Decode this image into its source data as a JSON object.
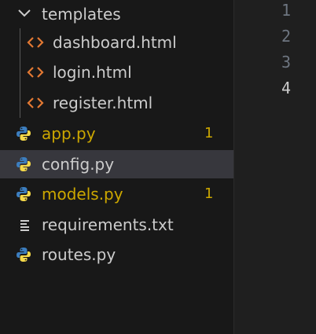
{
  "explorer": {
    "folder": {
      "name": "templates",
      "expanded": true,
      "icon": "chevron-down-icon"
    },
    "folder_files": [
      {
        "name": "dashboard.html",
        "icon": "html-icon"
      },
      {
        "name": "login.html",
        "icon": "html-icon"
      },
      {
        "name": "register.html",
        "icon": "html-icon"
      }
    ],
    "files": [
      {
        "name": "app.py",
        "icon": "python-icon",
        "badge": "1",
        "status": "warning"
      },
      {
        "name": "config.py",
        "icon": "python-icon",
        "badge": "",
        "status": "selected"
      },
      {
        "name": "models.py",
        "icon": "python-icon",
        "badge": "1",
        "status": "warning"
      },
      {
        "name": "requirements.txt",
        "icon": "text-file-icon",
        "badge": "",
        "status": ""
      },
      {
        "name": "routes.py",
        "icon": "python-icon",
        "badge": "",
        "status": ""
      }
    ]
  },
  "editor": {
    "line_numbers": [
      "1",
      "2",
      "3",
      "4"
    ],
    "active_line": "4"
  },
  "colors": {
    "warning": "#cca700",
    "html_icon": "#e37933",
    "python_blue": "#3c7ebf",
    "python_yellow": "#f5d94a",
    "selected_row": "#37373d"
  }
}
